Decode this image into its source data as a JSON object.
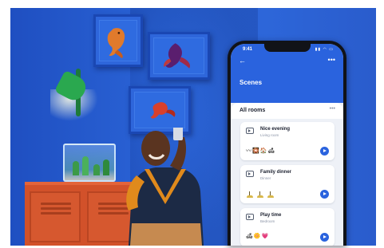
{
  "status_bar": {
    "time": "9:41",
    "icons": "▮▮ ◠ ▭"
  },
  "header": {
    "back_icon": "arrow-left-icon",
    "back_symbol": "←",
    "more_symbol": "•••",
    "title": "Scenes"
  },
  "section": {
    "title": "All rooms",
    "more_symbol": "•••"
  },
  "scenes": [
    {
      "name": "Nice evening",
      "room": "Living room",
      "icons": "〰🎇🏠🛋"
    },
    {
      "name": "Family dinner",
      "room": "Dinner",
      "icons": ""
    },
    {
      "name": "Play time",
      "room": "Bedroom",
      "icons": "🛋🌼💗"
    }
  ],
  "colors": {
    "brand_blue": "#2a63de",
    "wall_blue": "#2a5ccc",
    "cabinet_orange": "#d2512a",
    "lamp_green": "#2aa84f"
  }
}
